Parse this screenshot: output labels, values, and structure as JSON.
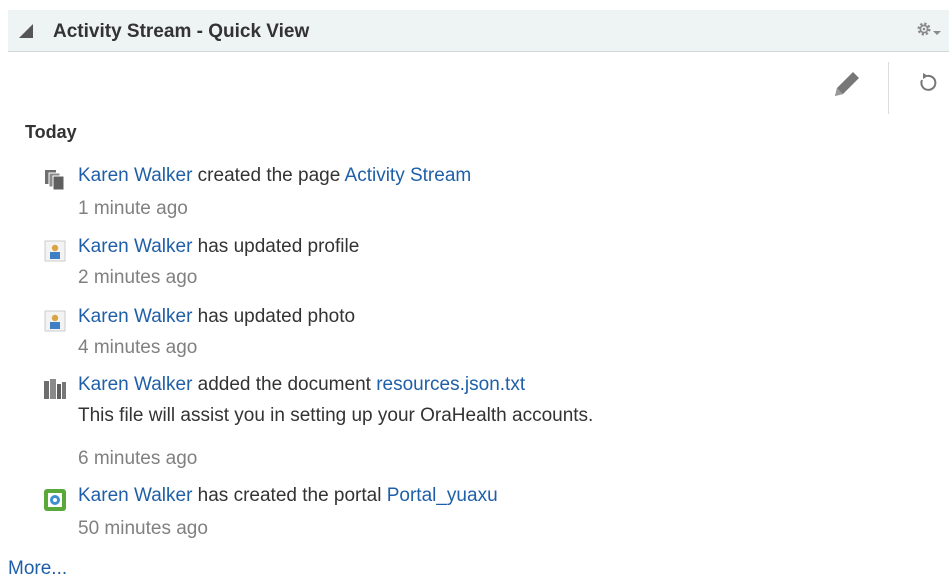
{
  "header": {
    "title": "Activity Stream - Quick View",
    "icon_collapse": "collapse-triangle-icon",
    "icon_settings": "gear-icon"
  },
  "toolbar": {
    "edit_icon": "pencil-icon",
    "refresh_icon": "refresh-icon"
  },
  "section": {
    "heading": "Today"
  },
  "activities": [
    {
      "icon": "pages-icon",
      "actor": "Karen Walker",
      "action": " created the page ",
      "object": "Activity Stream",
      "time": "1 minute ago"
    },
    {
      "icon": "profile-icon",
      "actor": "Karen Walker",
      "action": " has updated profile",
      "time": "2 minutes ago"
    },
    {
      "icon": "profile-icon",
      "actor": "Karen Walker",
      "action": " has updated photo",
      "time": "4 minutes ago"
    },
    {
      "icon": "document-library-icon",
      "actor": "Karen Walker",
      "action": " added the document ",
      "object": "resources.json.txt",
      "description": "This file will assist you in setting up your OraHealth accounts.",
      "time": "6 minutes ago"
    },
    {
      "icon": "portal-icon",
      "actor": "Karen Walker",
      "action": " has created the portal ",
      "object": "Portal_yuaxu",
      "time": "50 minutes ago"
    }
  ],
  "more_label": "More...",
  "colors": {
    "link": "#1f5fa8",
    "header_bg": "#eef3f4",
    "muted_text": "#808080",
    "text": "#333333"
  }
}
